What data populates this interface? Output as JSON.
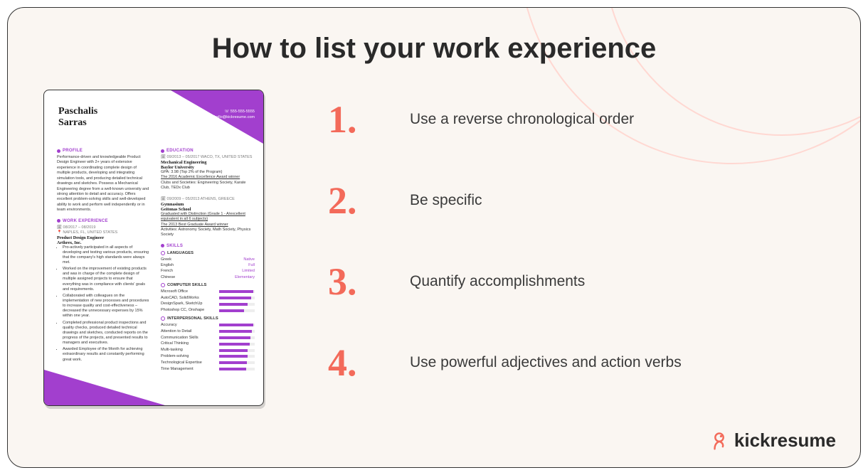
{
  "title": "How to list your work experience",
  "tips": [
    {
      "num": "1.",
      "text": "Use a reverse chronological order"
    },
    {
      "num": "2.",
      "text": "Be specific"
    },
    {
      "num": "3.",
      "text": "Quantify accomplishments"
    },
    {
      "num": "4.",
      "text": "Use powerful adjectives and action verbs"
    }
  ],
  "brand": "kickresume",
  "resume": {
    "first_name": "Paschalis",
    "last_name": "Sarras",
    "contact_phone": "555-555-5555",
    "contact_email": "hello@kickresume.com",
    "profile_h": "PROFILE",
    "profile": "Performance-driven and knowledgeable Product Design Engineer with 2+ years of extensive experience in coordinating complete design of multiple products, developing and integrating simulation tools, and producing detailed technical drawings and sketches. Possess a Mechanical Engineering degree from a well-known university and strong attention to detail and accuracy. Offers excellent problem-solving skills and well-developed ability to work and perform well independently or in team environments.",
    "work_h": "WORK EXPERIENCE",
    "work_meta_dates": "08/2017 – 08/2019",
    "work_meta_loc": "NAPLES, FL, UNITED STATES",
    "work_title": "Product Design Engineer",
    "work_company": "Arthrex, Inc.",
    "work_bullets": [
      "Pro-actively participated in all aspects of developing and testing various products, ensuring that the company's high standards were always met.",
      "Worked on the improvement of existing products and was in charge of the complete design of multiple assigned projects to ensure that everything was in compliance with clients' goals and requirements.",
      "Collaborated with colleagues on the implementation of new processes and procedures to increase quality and cost-effectiveness – decreased the unnecessary expenses by 15% within one year.",
      "Completed professional product inspections and quality checks, produced detailed technical drawings and sketches, conducted reports on the progress of the projects, and presented results to managers and executives.",
      "Awarded Employee of the Month for achieving extraordinary results and constantly performing great work."
    ],
    "edu_h": "EDUCATION",
    "edu1_meta": "09/2013 – 05/2017   WACO, TX, UNITED STATES",
    "edu1_title": "Mechanical Engineering",
    "edu1_school": "Baylor University",
    "edu1_l1": "GPA: 3.98 (Top 2% of the Program)",
    "edu1_l2": "The 2016 Academic Excellence Award winner",
    "edu1_l3": "Clubs and Societies: Engineering Society, Karate Club, TEDx Club",
    "edu2_meta": "09/2009 – 05/2013   ATHENS, GREECE",
    "edu2_title": "Gymnasium",
    "edu2_school": "Geitonas School",
    "edu2_l1": "Graduated with Distinction (Grade 1 - A/excellent equivalent in all 6 subjects)",
    "edu2_l2": "The 2013 Best Graduate Award winner",
    "edu2_l3": "Activities: Astronomy Society, Math Society, Physics Society",
    "skills_h": "SKILLS",
    "lang_h": "LANGUAGES",
    "langs": [
      {
        "name": "Greek",
        "level": "Native"
      },
      {
        "name": "English",
        "level": "Full"
      },
      {
        "name": "French",
        "level": "Limited"
      },
      {
        "name": "Chinese",
        "level": "Elementary"
      }
    ],
    "comp_h": "COMPUTER SKILLS",
    "comp": [
      {
        "name": "Microsoft Office",
        "v": 95
      },
      {
        "name": "AutoCAD, SolidWorks",
        "v": 90
      },
      {
        "name": "DesignSpark, SketchUp",
        "v": 80
      },
      {
        "name": "Photoshop CC, Onshape",
        "v": 70
      }
    ],
    "inter_h": "INTERPERSONAL SKILLS",
    "inter": [
      {
        "name": "Accuracy",
        "v": 95
      },
      {
        "name": "Attention to Detail",
        "v": 92
      },
      {
        "name": "Communication Skills",
        "v": 88
      },
      {
        "name": "Critical Thinking",
        "v": 85
      },
      {
        "name": "Multi-tasking",
        "v": 80
      },
      {
        "name": "Problem-solving",
        "v": 80
      },
      {
        "name": "Technological Expertise",
        "v": 78
      },
      {
        "name": "Time Management",
        "v": 75
      }
    ]
  }
}
